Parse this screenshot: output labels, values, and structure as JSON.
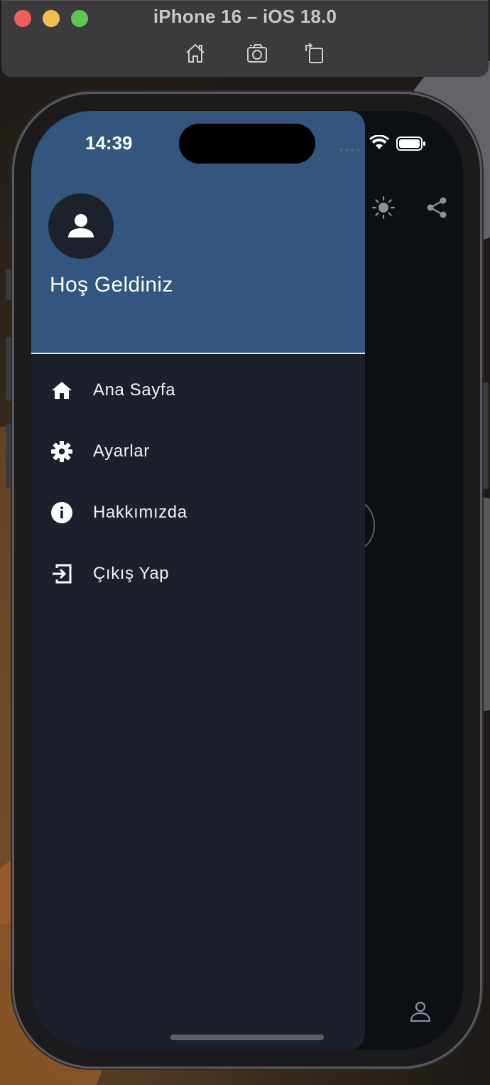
{
  "simulator": {
    "title": "iPhone 16 – iOS 18.0",
    "toolbar_icons": [
      "home-icon",
      "screenshot-icon",
      "rotate-icon"
    ]
  },
  "status_bar": {
    "time": "14:39",
    "icons": [
      "signal-icon",
      "wifi-icon",
      "battery-icon"
    ]
  },
  "drawer": {
    "header": {
      "welcome": "Hoş Geldiniz",
      "avatar_icon": "person-icon",
      "background_color": "#34557e"
    },
    "items": [
      {
        "label": "Ana Sayfa",
        "icon": "home-icon"
      },
      {
        "label": "Ayarlar",
        "icon": "settings-icon"
      },
      {
        "label": "Hakkımızda",
        "icon": "info-icon"
      },
      {
        "label": "Çıkış Yap",
        "icon": "logout-icon"
      }
    ]
  },
  "app_behind": {
    "icons": [
      "brightness-icon",
      "share-icon",
      "profile-icon"
    ]
  },
  "colors": {
    "drawer_bg": "#1c202b",
    "header_bg": "#34557e",
    "text": "#ffffff"
  }
}
